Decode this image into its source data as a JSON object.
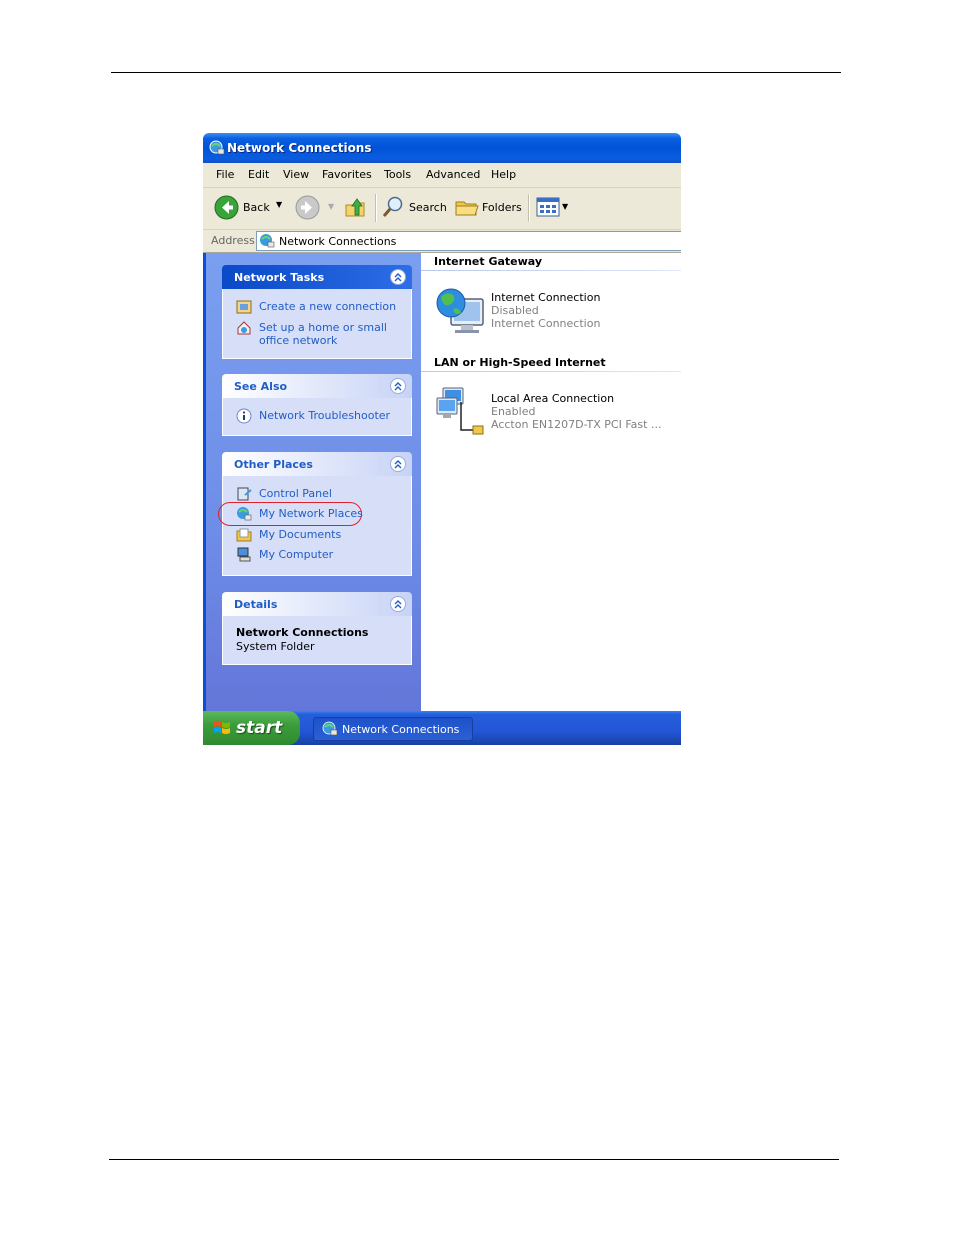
{
  "window": {
    "title": "Network Connections",
    "menu": [
      "File",
      "Edit",
      "View",
      "Favorites",
      "Tools",
      "Advanced",
      "Help"
    ],
    "toolbar": {
      "back_label": "Back",
      "search_label": "Search",
      "folders_label": "Folders"
    },
    "address": {
      "label": "Address",
      "value": "Network Connections"
    }
  },
  "left_pane": {
    "network_tasks": {
      "title": "Network Tasks",
      "items": [
        "Create a new connection",
        "Set up a home or small",
        "office network"
      ]
    },
    "see_also": {
      "title": "See Also",
      "items": [
        "Network Troubleshooter"
      ]
    },
    "other_places": {
      "title": "Other Places",
      "items": [
        "Control Panel",
        "My Network Places",
        "My Documents",
        "My Computer"
      ]
    },
    "details": {
      "title": "Details",
      "name": "Network Connections",
      "type": "System Folder"
    }
  },
  "right_pane": {
    "groups": [
      {
        "title": "Internet Gateway",
        "connection": {
          "name": "Internet Connection",
          "status": "Disabled",
          "device": "Internet Connection"
        }
      },
      {
        "title": "LAN or High-Speed Internet",
        "connection": {
          "name": "Local Area Connection",
          "status": "Enabled",
          "device": "Accton EN1207D-TX PCI Fast ..."
        }
      }
    ]
  },
  "taskbar": {
    "start_label": "start",
    "task_button_label": "Network Connections"
  },
  "colors": {
    "titlebar": "#0152d8",
    "link": "#215dc6",
    "highlight_ring": "#e0202a",
    "start_green": "#3c9d3c"
  }
}
